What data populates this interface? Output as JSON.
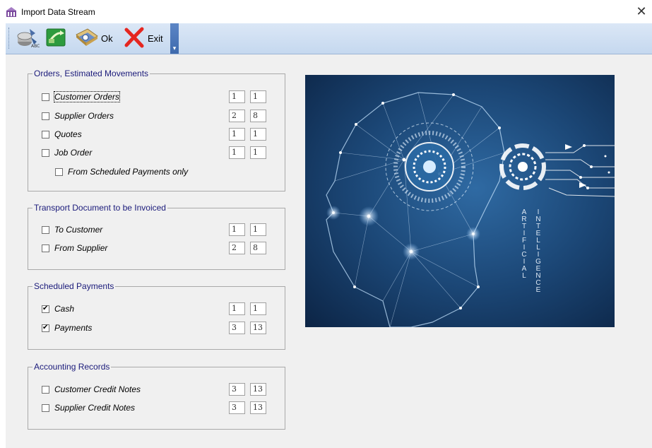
{
  "window": {
    "title": "Import Data Stream",
    "close_symbol": "✕"
  },
  "toolbar": {
    "buttons": [
      {
        "name": "connect-database-icon"
      },
      {
        "name": "refresh-stream-icon"
      },
      {
        "name": "process-records-icon"
      }
    ],
    "ok_label": "Ok",
    "exit_label": "Exit",
    "overflow_symbol": "▾"
  },
  "groups": {
    "orders": {
      "title": "Orders, Estimated Movements",
      "rows": [
        {
          "label": "Customer Orders",
          "checked": false,
          "v1": "1",
          "v2": "1"
        },
        {
          "label": "Supplier Orders",
          "checked": false,
          "v1": "2",
          "v2": "8"
        },
        {
          "label": "Quotes",
          "checked": false,
          "v1": "1",
          "v2": "1"
        },
        {
          "label": "Job Order",
          "checked": false,
          "v1": "1",
          "v2": "1"
        }
      ],
      "sub_option": {
        "label": "From Scheduled Payments only",
        "checked": false
      }
    },
    "transport": {
      "title": "Transport Document to be Invoiced",
      "rows": [
        {
          "label": "To Customer",
          "checked": false,
          "v1": "1",
          "v2": "1"
        },
        {
          "label": "From Supplier",
          "checked": false,
          "v1": "2",
          "v2": "8"
        }
      ]
    },
    "scheduled": {
      "title": "Scheduled Payments",
      "rows": [
        {
          "label": "Cash",
          "checked": true,
          "v1": "1",
          "v2": "1"
        },
        {
          "label": "Payments",
          "checked": true,
          "v1": "3",
          "v2": "13"
        }
      ]
    },
    "accounting": {
      "title": "Accounting Records",
      "rows": [
        {
          "label": "Customer Credit Notes",
          "checked": false,
          "v1": "3",
          "v2": "13"
        },
        {
          "label": "Supplier Credit Notes",
          "checked": false,
          "v1": "3",
          "v2": "13"
        }
      ]
    }
  },
  "image": {
    "vertical_text_left": "ARTIFICIAL",
    "vertical_text_right": "INTELLIGENCE"
  },
  "colors": {
    "toolbar": "#c5d8ef",
    "group_title": "#1a1a7a",
    "image_bg": "#163a63"
  }
}
